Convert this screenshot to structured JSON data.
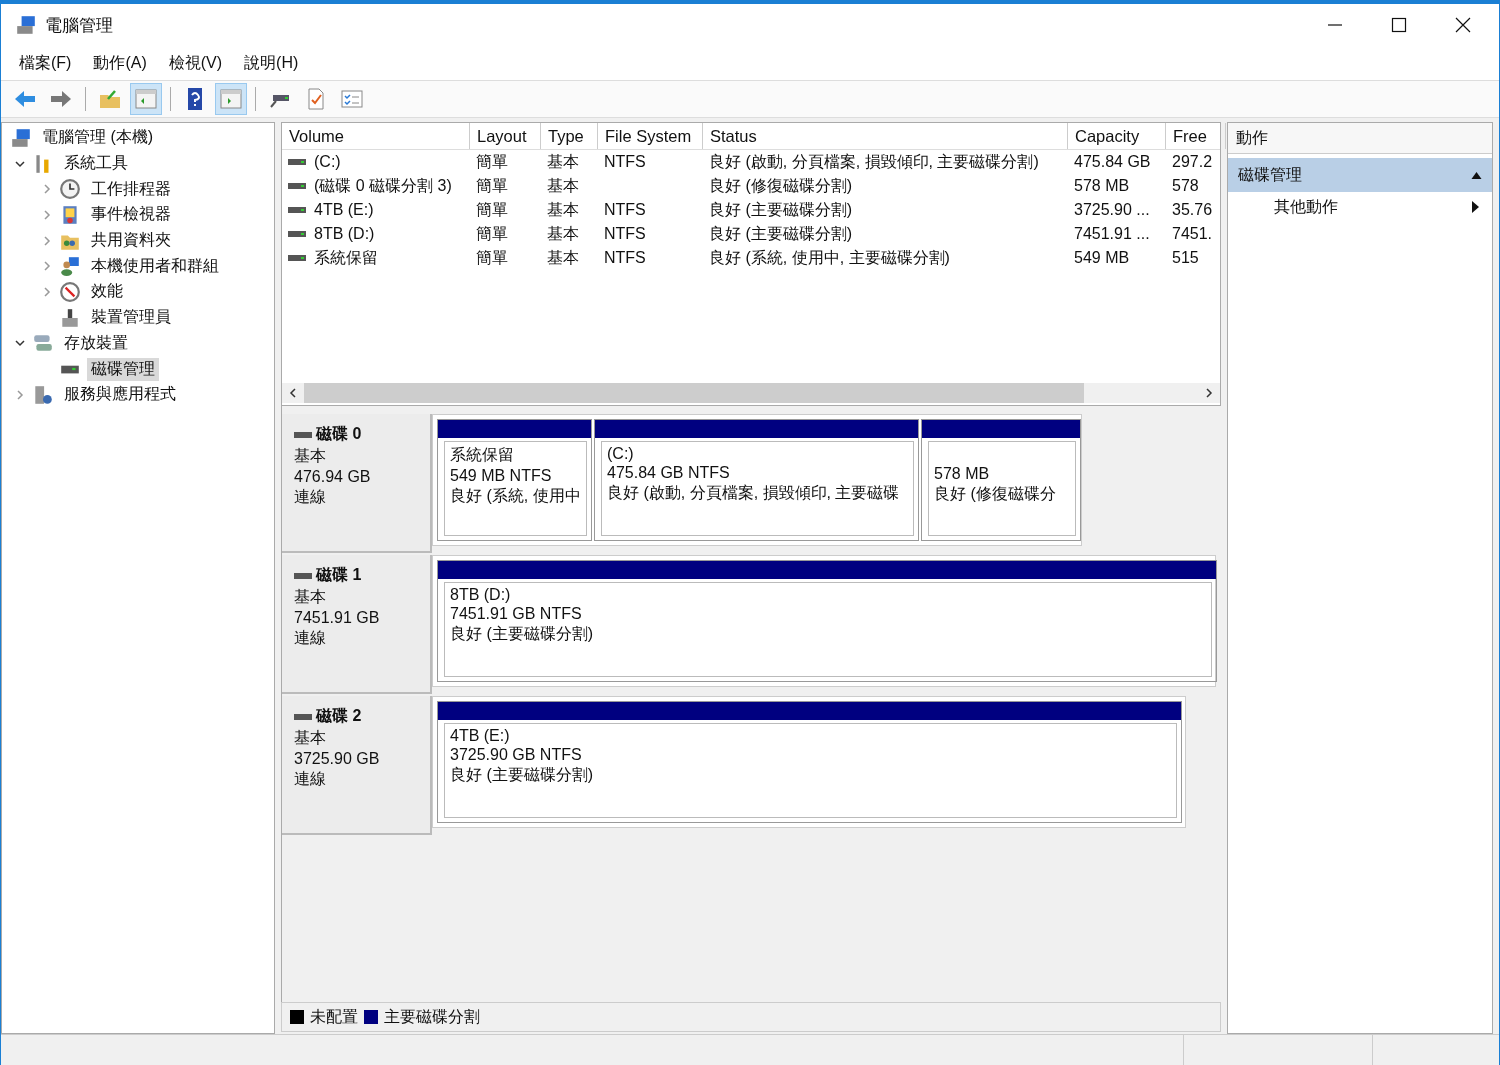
{
  "window": {
    "title": "電腦管理"
  },
  "menu": [
    "檔案(F)",
    "動作(A)",
    "檢視(V)",
    "說明(H)"
  ],
  "toolbar": [
    {
      "kind": "back"
    },
    {
      "kind": "forward"
    },
    {
      "kind": "separator"
    },
    {
      "kind": "up-folder"
    },
    {
      "kind": "tree-pane",
      "on": true
    },
    {
      "kind": "separator"
    },
    {
      "kind": "help"
    },
    {
      "kind": "action-pane",
      "on": true
    },
    {
      "kind": "separator"
    },
    {
      "kind": "connect"
    },
    {
      "kind": "check"
    },
    {
      "kind": "list"
    }
  ],
  "tree": [
    {
      "label": "電腦管理 (本機)",
      "selected": false,
      "children": [
        {
          "label": "系統工具",
          "selected": false,
          "expanded": true,
          "children": [
            {
              "label": "工作排程器",
              "selected": false,
              "expanded": false
            },
            {
              "label": "事件檢視器",
              "selected": false,
              "expanded": false
            },
            {
              "label": "共用資料夾",
              "selected": false,
              "expanded": false
            },
            {
              "label": "本機使用者和群組",
              "selected": false,
              "expanded": false
            },
            {
              "label": "效能",
              "selected": false,
              "expanded": false
            },
            {
              "label": "裝置管理員",
              "selected": false
            }
          ]
        },
        {
          "label": "存放裝置",
          "selected": false,
          "expanded": true,
          "children": [
            {
              "label": "磁碟管理",
              "selected": true
            }
          ]
        },
        {
          "label": "服務與應用程式",
          "selected": false,
          "expanded": false
        }
      ]
    }
  ],
  "table": {
    "columns": [
      "Volume",
      "Layout",
      "Type",
      "File System",
      "Status",
      "Capacity",
      "Free"
    ],
    "rows": [
      [
        "(C:)",
        "簡單",
        "基本",
        "NTFS",
        "良好 (啟動, 分頁檔案, 損毀傾印, 主要磁碟分割)",
        "475.84 GB",
        "297.2"
      ],
      [
        "(磁碟 0 磁碟分割 3)",
        "簡單",
        "基本",
        "",
        "良好 (修復磁碟分割)",
        "578 MB",
        "578"
      ],
      [
        "4TB (E:)",
        "簡單",
        "基本",
        "NTFS",
        "良好 (主要磁碟分割)",
        "3725.90 ...",
        "35.76"
      ],
      [
        "8TB (D:)",
        "簡單",
        "基本",
        "NTFS",
        "良好 (主要磁碟分割)",
        "7451.91 ...",
        "7451."
      ],
      [
        "系統保留",
        "簡單",
        "基本",
        "NTFS",
        "良好 (系統, 使用中, 主要磁碟分割)",
        "549 MB",
        "515"
      ]
    ]
  },
  "disks": [
    {
      "name": "磁碟 0",
      "type": "基本",
      "size": "476.94 GB",
      "state": "連線",
      "partitions": [
        {
          "label": "系統保留",
          "detail": "549 MB NTFS",
          "status": "良好 (系統, 使用中"
        },
        {
          "label": "(C:)",
          "detail": "475.84 GB NTFS",
          "status": "良好 (啟動, 分頁檔案, 損毀傾印, 主要磁碟"
        },
        {
          "detail": "578 MB",
          "status": "良好 (修復磁碟分"
        }
      ]
    },
    {
      "name": "磁碟 1",
      "type": "基本",
      "size": "7451.91 GB",
      "state": "連線",
      "partitions": [
        {
          "label": "8TB  (D:)",
          "detail": "7451.91 GB NTFS",
          "status": "良好 (主要磁碟分割)"
        }
      ]
    },
    {
      "name": "磁碟 2",
      "type": "基本",
      "size": "3725.90 GB",
      "state": "連線",
      "partitions": [
        {
          "label": "4TB  (E:)",
          "detail": "3725.90 GB NTFS",
          "status": "良好 (主要磁碟分割)"
        }
      ]
    }
  ],
  "legend": [
    {
      "label": "未配置",
      "color": "#000000"
    },
    {
      "label": "主要磁碟分割",
      "color": "#000080"
    }
  ],
  "actions": {
    "title": "動作",
    "section": {
      "label": "磁碟管理",
      "expanded": true
    },
    "items": [
      "其他動作"
    ]
  }
}
